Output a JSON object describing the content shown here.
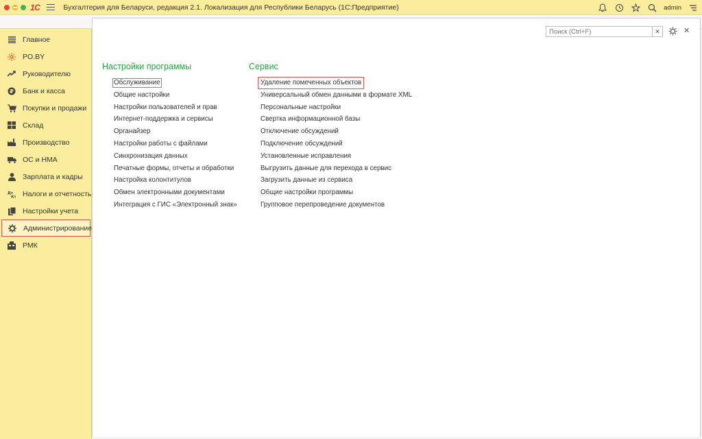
{
  "titlebar": {
    "logo": "1С",
    "title": "Бухгалтерия для Беларуси, редакция 2.1. Локализация для Республики Беларусь   (1С:Предприятие)",
    "user": "admin"
  },
  "sidebar": {
    "items": [
      {
        "label": "Главное",
        "icon": "menu-lines-icon"
      },
      {
        "label": "PO.BY",
        "icon": "sun-icon"
      },
      {
        "label": "Руководителю",
        "icon": "trend-icon"
      },
      {
        "label": "Банк и касса",
        "icon": "coin-icon"
      },
      {
        "label": "Покупки и продажи",
        "icon": "cart-icon"
      },
      {
        "label": "Склад",
        "icon": "warehouse-icon"
      },
      {
        "label": "Производство",
        "icon": "factory-icon"
      },
      {
        "label": "ОС и НМА",
        "icon": "truck-icon"
      },
      {
        "label": "Зарплата и кадры",
        "icon": "person-icon"
      },
      {
        "label": "Налоги и отчетность",
        "icon": "tax-icon"
      },
      {
        "label": "Настройки учета",
        "icon": "book-icon"
      },
      {
        "label": "Администрирование",
        "icon": "gear-icon"
      },
      {
        "label": "РМК",
        "icon": "register-icon"
      }
    ]
  },
  "main": {
    "search_placeholder": "Поиск (Ctrl+F)",
    "left": {
      "title": "Настройки программы",
      "items": [
        "Обслуживание",
        "Общие настройки",
        "Настройки пользователей и прав",
        "Интернет-поддержка и сервисы",
        "Органайзер",
        "Настройки работы с файлами",
        "Синхронизация данных",
        "Печатные формы, отчеты и обработки",
        "Настройка колонтитулов",
        "Обмен электронными документами",
        "Интеграция с ГИС «Электронный знак»"
      ]
    },
    "right": {
      "title": "Сервис",
      "items": [
        "Удаление помеченных объектов",
        "Универсальный обмен данными в формате XML",
        "Персональные настройки",
        "Свертка информационной базы",
        "Отключение обсуждений",
        "Подключение обсуждений",
        "Установленные исправления",
        "Выгрузить данные для перехода в сервис",
        "Загрузить данные из сервиса",
        "Общие настройки программы",
        "Групповое перепроведение документов"
      ]
    }
  },
  "colors": {
    "sidebar_bg": "#fbed9e",
    "section_title": "#2c9f45",
    "highlight": "#d9534f"
  }
}
